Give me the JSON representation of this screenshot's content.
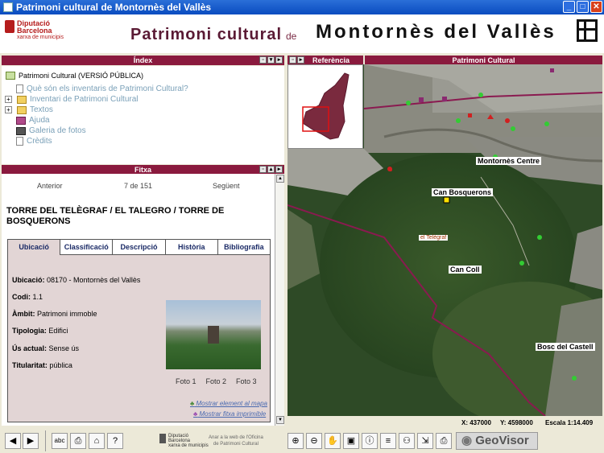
{
  "window": {
    "title": "Patrimoni cultural de Montornès del Vallès"
  },
  "header": {
    "logo_line1": "Diputació",
    "logo_line2": "Barcelona",
    "logo_line3": "xarxa de municipis",
    "title_part1": "Patrimoni cultural",
    "title_part2": "de",
    "title_part3": "Montornès del Vallès"
  },
  "index_panel": {
    "title": "Índex",
    "root": "Patrimoni Cultural (VERSIÓ PÚBLICA)",
    "items": [
      {
        "label": "Què són els inventaris de Patrimoni Cultural?",
        "icon": "page-icon"
      },
      {
        "label": "Inventari de Patrimoni Cultural",
        "icon": "folder-icon"
      },
      {
        "label": "Textos",
        "icon": "folder-icon"
      },
      {
        "label": "Ajuda",
        "icon": "book-icon"
      },
      {
        "label": "Galeria de fotos",
        "icon": "camera-icon"
      },
      {
        "label": "Crèdits",
        "icon": "page-icon"
      }
    ]
  },
  "record_panel": {
    "title": "Fitxa",
    "prev": "Anterior",
    "position": "7 de 151",
    "next": "Següent",
    "record_title": "TORRE DEL TELÈGRAF / EL TALEGRO / TORRE DE BOSQUERONS",
    "tabs": [
      "Ubicació",
      "Classificació",
      "Descripció",
      "Història",
      "Bibliografia"
    ],
    "active_tab": "Ubicació",
    "fields": [
      {
        "label": "Ubicació:",
        "value": "08170 - Montornès del Vallès"
      },
      {
        "label": "Codi:",
        "value": "1.1"
      },
      {
        "label": "Àmbit:",
        "value": "Patrimoni immoble"
      },
      {
        "label": "Tipologia:",
        "value": "Edifici"
      },
      {
        "label": "Ús actual:",
        "value": "Sense ús"
      },
      {
        "label": "Titularitat:",
        "value": "pública"
      }
    ],
    "photos": [
      "Foto 1",
      "Foto 2",
      "Foto 3"
    ],
    "link_map": "Mostrar element al mapa",
    "link_print": "Mostrar fitxa imprimible"
  },
  "reference_panel": {
    "title": "Referència"
  },
  "map_panel": {
    "title": "Patrimoni Cultural",
    "labels": [
      "Montornès Centre",
      "Can Bosquerons",
      "el Telègraf",
      "Can Coll",
      "Bosc del Castell"
    ]
  },
  "status": {
    "x": "X: 437000",
    "y": "Y: 4598000",
    "scale": "Escala 1:14.409"
  },
  "footer": {
    "logo_line1": "Diputació",
    "logo_line2": "Barcelona",
    "logo_line3": "xarxa de municipis",
    "web_link_line1": "Anar a la web de l'Oficina",
    "web_link_line2": "de Patrimoni Cultural",
    "brand": "GeoVisor"
  }
}
